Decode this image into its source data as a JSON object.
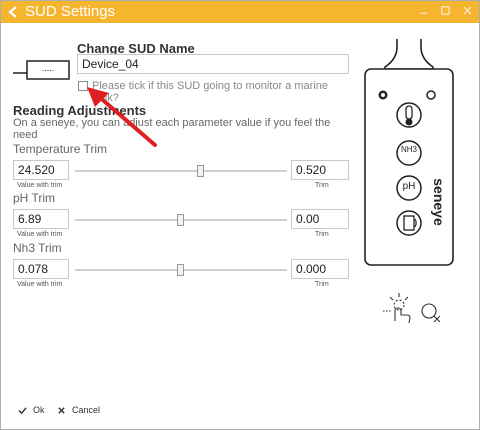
{
  "window": {
    "title": "SUD Settings"
  },
  "sud_name": {
    "heading": "Change SUD Name",
    "value": "Device_04",
    "connector_label": "....."
  },
  "marine": {
    "label": "Please tick if this SUD going to monitor a marine tank?",
    "checked": false
  },
  "reading": {
    "heading": "Reading Adjustments",
    "description": "On a seneye, you can adjust each parameter value if you feel the need"
  },
  "trims": [
    {
      "label": "Temperature Trim",
      "value_with_trim": "24.520",
      "value_label": "Value with trim",
      "trim": "0.520",
      "trim_label": "Trim",
      "slider_level": 0.52
    },
    {
      "label": "pH Trim",
      "value_with_trim": "6.89",
      "value_label": "Value with trim",
      "trim": "0.00",
      "trim_label": "Trim",
      "slider_level": 0.5
    },
    {
      "label": "Nh3 Trim",
      "value_with_trim": "0.078",
      "value_label": "Value with trim",
      "trim": "0.000",
      "trim_label": "Trim",
      "slider_level": 0.5
    }
  ],
  "device": {
    "brand": "seneye",
    "nh3_text": "NH3",
    "ph_text": "pH"
  },
  "footer": {
    "ok_label": "Ok",
    "cancel_label": "Cancel"
  },
  "colors": {
    "titlebar": "#f5b52f",
    "arrow": "#e02020"
  }
}
